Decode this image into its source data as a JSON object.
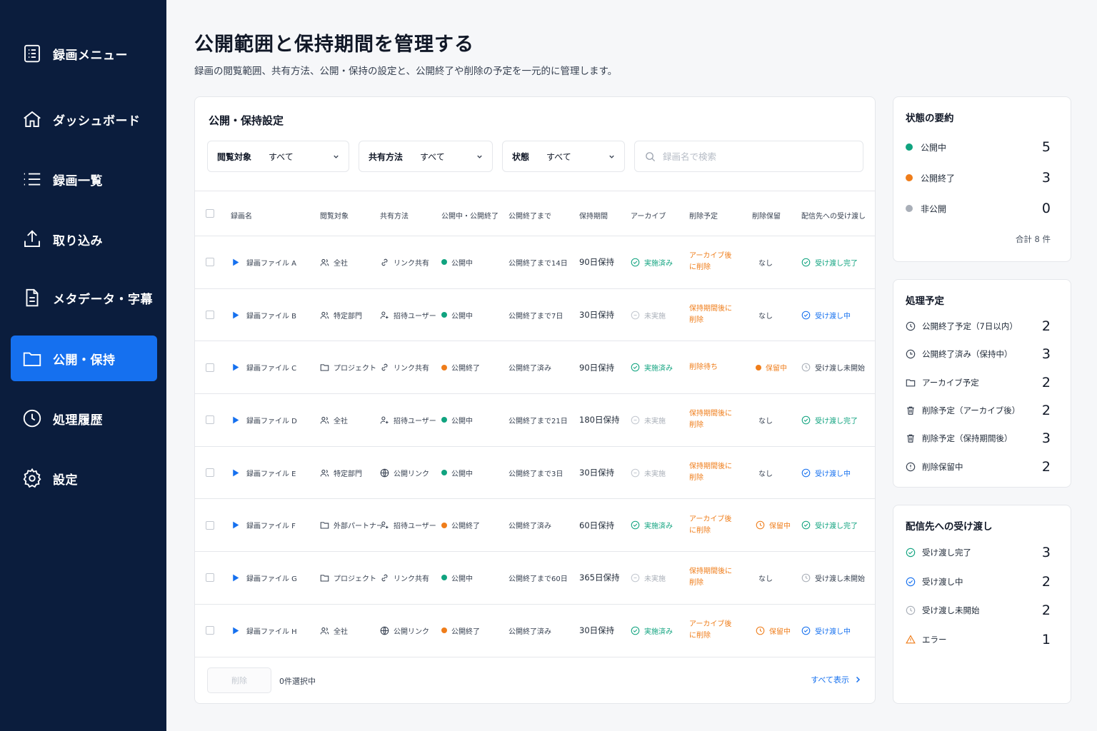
{
  "sidebar": {
    "items": [
      {
        "label": "録画メニュー",
        "icon": "list-doc-icon"
      },
      {
        "label": "ダッシュボード",
        "icon": "home-icon"
      },
      {
        "label": "録画一覧",
        "icon": "list-icon"
      },
      {
        "label": "取り込み",
        "icon": "upload-icon"
      },
      {
        "label": "メタデータ・字幕",
        "icon": "document-icon"
      },
      {
        "label": "公開・保持",
        "icon": "folder-icon",
        "active": true
      },
      {
        "label": "処理履歴",
        "icon": "clock-icon"
      },
      {
        "label": "設定",
        "icon": "gear-icon"
      }
    ]
  },
  "header": {
    "title": "公開範囲と保持期間を管理する",
    "subtitle": "録画の閲覧範囲、共有方法、公開・保持の設定と、公開終了や削除の予定を一元的に管理します。"
  },
  "main": {
    "title": "公開・保持設定",
    "filters": [
      {
        "label": "閲覧対象",
        "value": "すべて"
      },
      {
        "label": "共有方法",
        "value": "すべて"
      },
      {
        "label": "状態",
        "value": "すべて"
      }
    ],
    "search_placeholder": "録画名で検索",
    "columns": [
      "録画名",
      "閲覧対象",
      "共有方法",
      "公開中・公開終了",
      "公開終了まで",
      "保持期間",
      "アーカイブ",
      "削除予定",
      "削除保留",
      "配信先への受け渡し"
    ],
    "rows": [
      {
        "name": "録画ファイル A",
        "audience": "全社",
        "audience_icon": "users-icon",
        "share": "リンク共有",
        "share_icon": "link-icon",
        "status": "公開中",
        "status_color": "green",
        "until": "公開終了まで14日",
        "retention": "90日保持",
        "archive": "実施済み",
        "archive_state": "done",
        "deletion": "アーカイブ後に削除",
        "deletion_color": "orange",
        "hold": "なし",
        "hold_state": "none",
        "delivery": "受け渡し完了",
        "delivery_state": "done"
      },
      {
        "name": "録画ファイル B",
        "audience": "特定部門",
        "audience_icon": "users-icon",
        "share": "招待ユーザー",
        "share_icon": "user-invite-icon",
        "status": "公開中",
        "status_color": "green",
        "until": "公開終了まで7日",
        "retention": "30日保持",
        "archive": "未実施",
        "archive_state": "pending",
        "deletion": "保持期間後に削除",
        "deletion_color": "orange",
        "hold": "なし",
        "hold_state": "none",
        "delivery": "受け渡し中",
        "delivery_state": "progress"
      },
      {
        "name": "録画ファイル C",
        "audience": "プロジェクト",
        "audience_icon": "folder-icon",
        "share": "リンク共有",
        "share_icon": "link-icon",
        "status": "公開終了",
        "status_color": "orange",
        "until": "公開終了済み",
        "retention": "90日保持",
        "archive": "実施済み",
        "archive_state": "done",
        "deletion": "削除待ち",
        "deletion_color": "orange",
        "hold": "保留中",
        "hold_state": "hold-dot",
        "delivery": "受け渡し未開始",
        "delivery_state": "notstarted"
      },
      {
        "name": "録画ファイル D",
        "audience": "全社",
        "audience_icon": "users-icon",
        "share": "招待ユーザー",
        "share_icon": "user-invite-icon",
        "status": "公開中",
        "status_color": "green",
        "until": "公開終了まで21日",
        "retention": "180日保持",
        "archive": "未実施",
        "archive_state": "pending",
        "deletion": "保持期間後に削除",
        "deletion_color": "orange",
        "hold": "なし",
        "hold_state": "none",
        "delivery": "受け渡し完了",
        "delivery_state": "done"
      },
      {
        "name": "録画ファイル E",
        "audience": "特定部門",
        "audience_icon": "users-icon",
        "share": "公開リンク",
        "share_icon": "globe-icon",
        "status": "公開中",
        "status_color": "green",
        "until": "公開終了まで3日",
        "retention": "30日保持",
        "archive": "未実施",
        "archive_state": "pending",
        "deletion": "保持期間後に削除",
        "deletion_color": "orange",
        "hold": "なし",
        "hold_state": "none",
        "delivery": "受け渡し中",
        "delivery_state": "progress"
      },
      {
        "name": "録画ファイル F",
        "audience": "外部パートナー",
        "audience_icon": "folder-icon",
        "share": "招待ユーザー",
        "share_icon": "user-invite-icon",
        "status": "公開終了",
        "status_color": "orange",
        "until": "公開終了済み",
        "retention": "60日保持",
        "archive": "実施済み",
        "archive_state": "done",
        "deletion": "アーカイブ後に削除",
        "deletion_color": "orange",
        "hold": "保留中",
        "hold_state": "hold-clock",
        "delivery": "受け渡し完了",
        "delivery_state": "done"
      },
      {
        "name": "録画ファイル G",
        "audience": "プロジェクト",
        "audience_icon": "folder-icon",
        "share": "リンク共有",
        "share_icon": "link-icon",
        "status": "公開中",
        "status_color": "green",
        "until": "公開終了まで60日",
        "retention": "365日保持",
        "archive": "未実施",
        "archive_state": "pending",
        "deletion": "保持期間後に削除",
        "deletion_color": "orange",
        "hold": "なし",
        "hold_state": "none",
        "delivery": "受け渡し未開始",
        "delivery_state": "notstarted"
      },
      {
        "name": "録画ファイル H",
        "audience": "全社",
        "audience_icon": "users-icon",
        "share": "公開リンク",
        "share_icon": "globe-icon",
        "status": "公開終了",
        "status_color": "orange",
        "until": "公開終了済み",
        "retention": "30日保持",
        "archive": "実施済み",
        "archive_state": "done",
        "deletion": "アーカイブ後に削除",
        "deletion_color": "orange",
        "hold": "保留中",
        "hold_state": "hold-clock",
        "delivery": "受け渡し中",
        "delivery_state": "progress"
      }
    ],
    "footer": {
      "delete_label": "削除",
      "selected_count": "0件選択中",
      "show_all": "すべて表示"
    }
  },
  "summary": {
    "title": "状態の要約",
    "items": [
      {
        "label": "公開中",
        "count": "5",
        "color": "#10a37f"
      },
      {
        "label": "公開終了",
        "count": "3",
        "color": "#ef7d1a"
      },
      {
        "label": "非公開",
        "count": "0",
        "color": "#a9afb8"
      }
    ],
    "total": "合計 8 件"
  },
  "schedule": {
    "title": "処理予定",
    "items": [
      {
        "label": "公開終了予定（7日以内）",
        "count": "2",
        "icon": "clock-icon"
      },
      {
        "label": "公開終了済み（保持中）",
        "count": "3",
        "icon": "clock-half-icon"
      },
      {
        "label": "アーカイブ予定",
        "count": "2",
        "icon": "folder-icon"
      },
      {
        "label": "削除予定（アーカイブ後）",
        "count": "2",
        "icon": "trash-icon"
      },
      {
        "label": "削除予定（保持期間後）",
        "count": "3",
        "icon": "trash-icon"
      },
      {
        "label": "削除保留中",
        "count": "2",
        "icon": "pause-circle-icon"
      }
    ]
  },
  "delivery": {
    "title": "配信先への受け渡し",
    "items": [
      {
        "label": "受け渡し完了",
        "count": "3",
        "icon": "check-circle-icon",
        "color": "#10a37f"
      },
      {
        "label": "受け渡し中",
        "count": "2",
        "icon": "progress-circle-icon",
        "color": "#1570ef"
      },
      {
        "label": "受け渡し未開始",
        "count": "2",
        "icon": "clock-icon",
        "color": "#a9afb8"
      },
      {
        "label": "エラー",
        "count": "1",
        "icon": "warning-icon",
        "color": "#ef7d1a"
      }
    ]
  }
}
